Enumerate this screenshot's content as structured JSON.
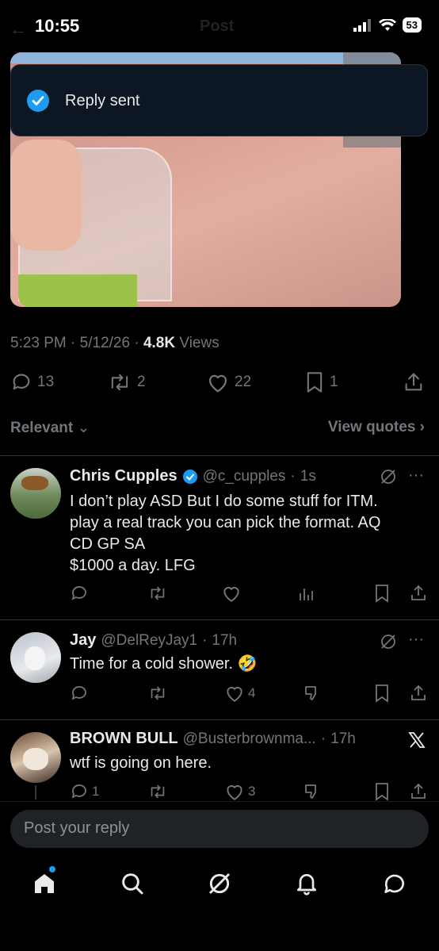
{
  "status_bar": {
    "time": "10:55",
    "battery": "53"
  },
  "header": {
    "title": "Post"
  },
  "toast": {
    "text": "Reply sent"
  },
  "post": {
    "time": "5:23 PM",
    "date": "5/12/26",
    "views_count": "4.8K",
    "views_label": "Views",
    "replies": "13",
    "reposts": "2",
    "likes": "22",
    "bookmarks": "1"
  },
  "filters": {
    "sort_label": "Relevant",
    "view_quotes": "View quotes"
  },
  "replies": [
    {
      "name": "Chris Cupples",
      "verified": true,
      "handle": "@c_cupples",
      "time": "1s",
      "text": "I don’t play ASD    But I do some stuff for ITM.\nplay a real track you can pick the format.  AQ\nCD GP SA\n$1000 a day.  LFG",
      "likes": ""
    },
    {
      "name": "Jay",
      "handle": "@DelReyJay1",
      "time": "17h",
      "text": "Time for a cold shower.",
      "emoji": "🤣",
      "likes": "4"
    },
    {
      "name": "BROWN BULL",
      "handle": "@Busterbrownma...",
      "time": "17h",
      "text": "wtf is going on here.",
      "replies": "1",
      "likes": "3"
    }
  ],
  "composer": {
    "placeholder": "Post your reply"
  },
  "colors": {
    "accent": "#1d9bf0",
    "muted": "#71767b",
    "background": "#000000"
  }
}
